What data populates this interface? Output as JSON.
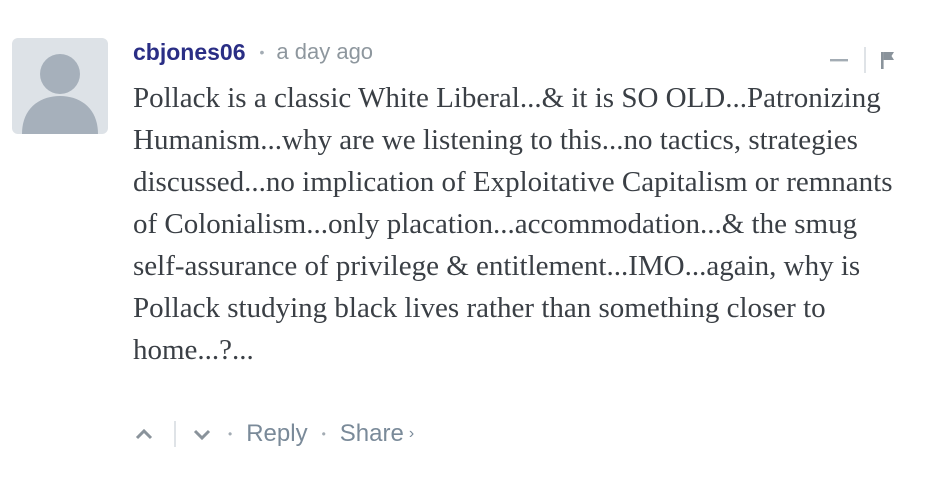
{
  "comment": {
    "author": "cbjones06",
    "separator": "•",
    "timestamp": "a day ago",
    "body": "Pollack is a classic White Liberal...& it is SO OLD...Patronizing Humanism...why are we listening to this...no tactics, strategies discussed...no implication of Exploitative Capitalism or remnants of Colonialism...only placation...accommodation...& the smug self-assurance of privilege & entitlement...IMO...again, why is Pollack studying black lives rather than something closer to home...?...",
    "icons": {
      "avatar": "default-avatar-icon",
      "collapse": "minus-icon",
      "flag": "flag-icon",
      "upvote": "chevron-up-icon",
      "downvote": "chevron-down-icon",
      "share_chevron": "chevron-right-icon"
    },
    "footer": {
      "separator": "•",
      "reply_label": "Reply",
      "share_label": "Share",
      "share_chevron": "›"
    }
  },
  "colors": {
    "author": "#2a2e85",
    "meta": "#8e979e",
    "body_text": "#3a3f45",
    "action": "#7a8a99",
    "avatar_bg": "#dde2e7",
    "avatar_fg": "#a6b0bb"
  }
}
